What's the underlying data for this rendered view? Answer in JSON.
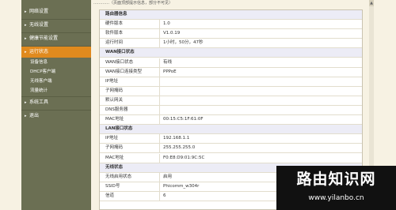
{
  "top_strip": "…………（页面顶部提示信息，部分不可见）",
  "sidebar": {
    "items": [
      {
        "label": "网络设置"
      },
      {
        "label": "无线设置"
      },
      {
        "label": "健康节能设置"
      },
      {
        "label": "运行状态"
      },
      {
        "label": "设备信息"
      },
      {
        "label": "DHCP客户端"
      },
      {
        "label": "无线客户端"
      },
      {
        "label": "流量统计"
      },
      {
        "label": "系统工具"
      },
      {
        "label": "退出"
      }
    ],
    "active_index": 3
  },
  "sections": [
    {
      "title": "路由器信息",
      "rows": [
        {
          "label": "硬件版本",
          "value": "1.0"
        },
        {
          "label": "软件版本",
          "value": "V1.0.19"
        },
        {
          "label": "运行时间",
          "value": "1小时，50分，47秒"
        }
      ]
    },
    {
      "title": "WAN接口状态",
      "rows": [
        {
          "label": "WAN接口状态",
          "value": "有线"
        },
        {
          "label": "WAN接口连接类型",
          "value": "PPPoE"
        },
        {
          "label": "IP地址",
          "value": ""
        },
        {
          "label": "子网掩码",
          "value": ""
        },
        {
          "label": "默认网关",
          "value": ""
        },
        {
          "label": "DNS服务器",
          "value": ""
        },
        {
          "label": "MAC地址",
          "value": "00:15:C5:1F:61:0F"
        }
      ]
    },
    {
      "title": "LAN接口状态",
      "rows": [
        {
          "label": "IP地址",
          "value": "192.168.1.1"
        },
        {
          "label": "子网掩码",
          "value": "255.255.255.0"
        },
        {
          "label": "MAC地址",
          "value": "F0:E8:D9:01:9C:5C"
        }
      ]
    },
    {
      "title": "无线状态",
      "rows": [
        {
          "label": "无线启用状态",
          "value": "启用"
        },
        {
          "label": "SSID号",
          "value": "Phicomm_w304r"
        },
        {
          "label": "信道",
          "value": "6"
        }
      ]
    }
  ],
  "watermark": {
    "title": "路由知识网",
    "url": "www.yilanbo.cn"
  },
  "colors": {
    "sidebar": "#6b6f53",
    "active": "#e08a1e",
    "section_bg": "#ececf6",
    "page_bg": "#f7f2e3"
  }
}
